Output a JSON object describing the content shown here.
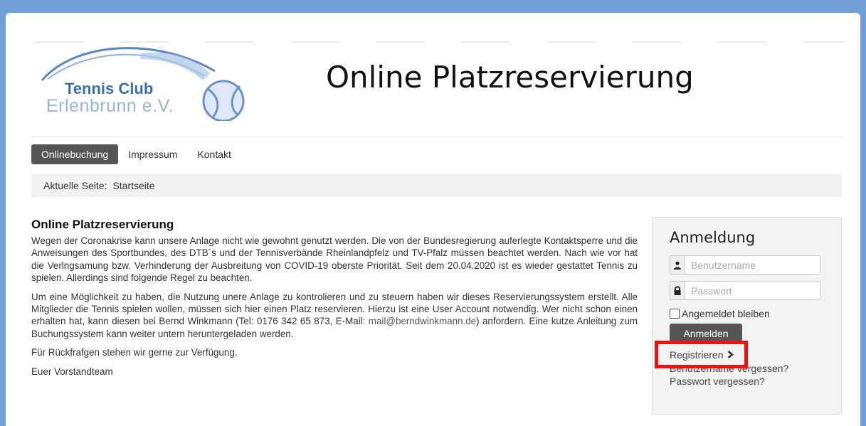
{
  "logo": {
    "line1": "Tennis Club",
    "line2": "Erlenbrunn e.V."
  },
  "header": {
    "title": "Online Platzreservierung"
  },
  "nav": {
    "items": [
      {
        "label": "Onlinebuchung",
        "active": true
      },
      {
        "label": "Impressum",
        "active": false
      },
      {
        "label": "Kontakt",
        "active": false
      }
    ]
  },
  "breadcrumb": {
    "label": "Aktuelle Seite:",
    "current": "Startseite"
  },
  "content": {
    "heading": "Online Platzreservierung",
    "p1": "Wegen der Coronakrise kann unsere Anlage nicht wie gewohnt genutzt werden. Die von der Bundesregierung auferlegte Kontaktsperre und die Anweisungen des Sportbundes, des DTB´s und der Tennisverbände Rheinlandpfelz und TV-Pfalz müssen beachtet werden. Nach wie vor hat die Verlngsamung bzw. Verhinderung der Ausbreitung von COVID-19 oberste Priorität. Seit dem 20.04.2020 ist es wieder gestattet Tennis zu spielen. Allerdings sind folgende Regel zu beachten.",
    "p2_before": "Um eine Möglichkeit zu haben, die Nutzung unere Anlage zu kontrolieren und zu steuern haben wir dieses Reservierungssystem erstellt. Alle Mitglieder die Tennis spielen wollen, müssen sich hier einen Platz reservieren. Hierzu ist eine User Account notwendig. Wer nicht schon einen erhalten hat, kann diesen bei Bernd Winkmann (Tel: 0176 342 65 873, E-Mail: ",
    "p2_email": "mail@berndwinkmann.de",
    "p2_after": ") anfordern. Eine kutze Anleitung zum Buchungssystem kann weiter untern heruntergeladen werden.",
    "p3": "Für Rückfrafgen stehen wir gerne zur Verfügung.",
    "p4": "Euer Vorstandteam"
  },
  "login": {
    "title": "Anmeldung",
    "username_placeholder": "Benutzername",
    "password_placeholder": "Passwort",
    "remember_label": "Angemeldet bleiben",
    "submit_label": "Anmelden",
    "register_label": "Registrieren",
    "forgot_username": "Benutzername vergessen?",
    "forgot_password": "Passwort vergessen?"
  },
  "icons": {
    "user": "user-icon",
    "lock": "lock-icon",
    "register_chevron": "chevron-right-icon",
    "tennis_ball": "tennis-ball-icon"
  },
  "colors": {
    "background": "#6f9ed8",
    "nav_active": "#555555",
    "highlight": "#ee1111",
    "logo_primary": "#3d6fae",
    "logo_secondary": "#9bb4d6"
  }
}
